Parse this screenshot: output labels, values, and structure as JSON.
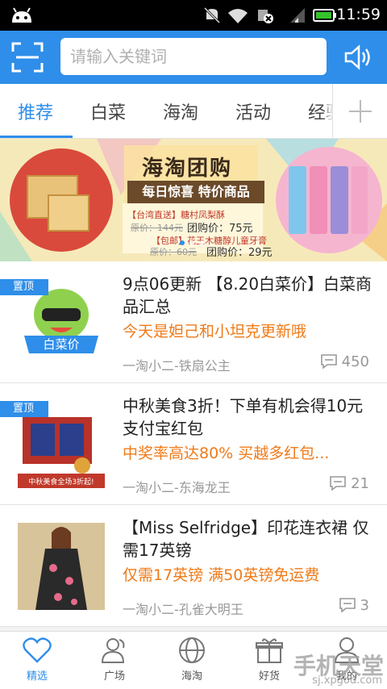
{
  "status_bar": {
    "time": "11:59"
  },
  "search": {
    "placeholder": "请输入关键词"
  },
  "tabs": [
    {
      "label": "推荐",
      "active": true
    },
    {
      "label": "白菜"
    },
    {
      "label": "海淘"
    },
    {
      "label": "活动"
    },
    {
      "label": "经验"
    }
  ],
  "banner": {
    "title": "海淘团购",
    "subtitle": "每日惊喜 特价商品",
    "line1_tag": "【台湾直送】糖村凤梨酥",
    "line1_old": "原价：144元",
    "line1_price": "团购价：75元",
    "line2_tag": "【包邮】花王木糖醇儿童牙膏",
    "line2_old": "原价：60元",
    "line2_price": "团购价：29元"
  },
  "items": [
    {
      "pinned": true,
      "pin_label": "置顶",
      "title": "9点06更新 【8.20白菜价】白菜商品汇总",
      "subtitle": "今天是妲己和小坦克更新哦",
      "author": "一淘小二-铁扇公主",
      "comments": "450",
      "thumb_text": "白菜价"
    },
    {
      "pinned": true,
      "pin_label": "置顶",
      "title": "中秋美食3折！下单有机会得10元支付宝红包",
      "subtitle": "中奖率高达80% 买越多红包...",
      "author": "一淘小二-东海龙王",
      "comments": "21",
      "thumb_text": "中秋美食全场3折起!"
    },
    {
      "pinned": false,
      "title": "【Miss Selfridge】印花连衣裙 仅需17英镑",
      "subtitle": "仅需17英镑 满50英镑免运费",
      "author": "一淘小二-孔雀大明王",
      "comments": "3"
    }
  ],
  "bottom_nav": [
    {
      "label": "精选",
      "icon": "heart-icon",
      "active": true
    },
    {
      "label": "广场",
      "icon": "people-icon"
    },
    {
      "label": "海淘",
      "icon": "globe-icon"
    },
    {
      "label": "好货",
      "icon": "gift-icon"
    },
    {
      "label": "我的",
      "icon": "user-icon"
    }
  ],
  "watermark": {
    "main": "手机天堂",
    "url": "sj.xpgod.com"
  },
  "colors": {
    "accent": "#2e8ee9",
    "highlight": "#f07a18"
  }
}
